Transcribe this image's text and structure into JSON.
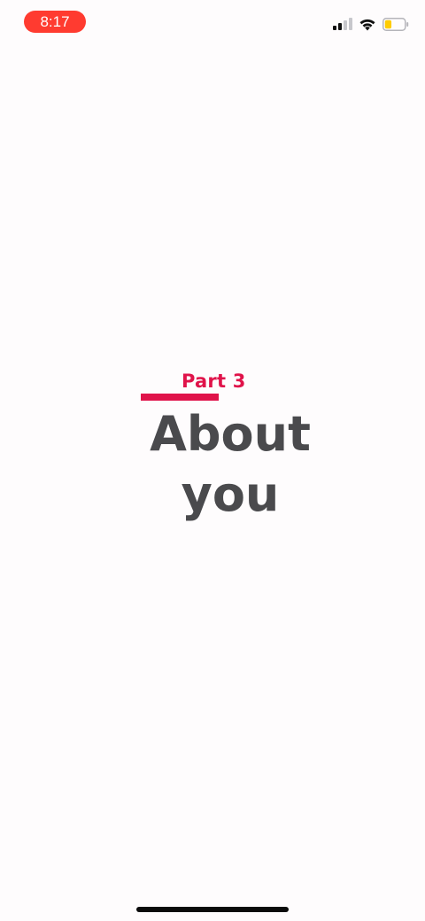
{
  "status_bar": {
    "time": "8:17",
    "time_pill_color": "#ff3b30",
    "icons": [
      "cellular-signal-icon",
      "wifi-icon",
      "battery-icon"
    ],
    "battery_level": 0.35,
    "battery_color": "#ffcc00"
  },
  "main": {
    "part_label": "Part 3",
    "title_line1": "About",
    "title_line2": "you",
    "accent_color": "#e0134a",
    "title_color": "#4a4a4d"
  }
}
